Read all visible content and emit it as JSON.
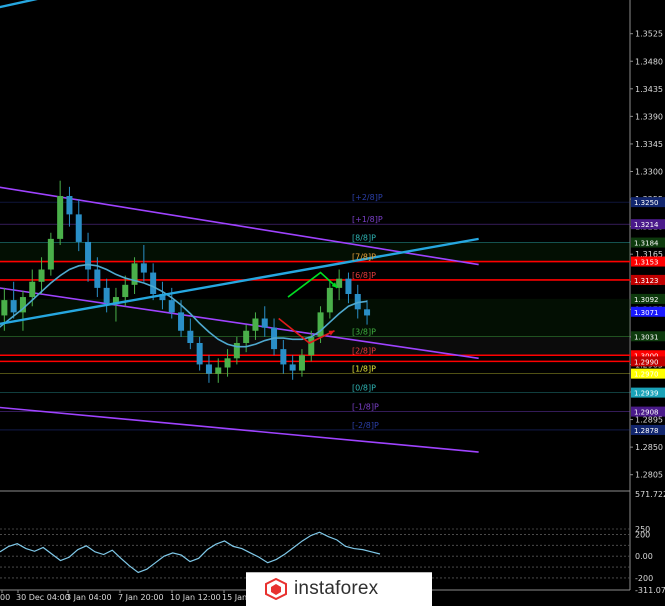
{
  "colors": {
    "background": "#000000",
    "axis": "#8c8c8c",
    "trend": "#26a7e0",
    "channel": "#9f43ff",
    "ma": "#4fa9cf",
    "bull": "#4ab04a",
    "bear": "#2a8fc7",
    "osc": "#7fc8e8",
    "level_red": "#ff0000",
    "arrow_up": "#00dd22",
    "arrow_down": "#e21a1a",
    "murrey_band_up": "#0d3a0d",
    "murrey_band_mid": "#2a2a2a",
    "logo_red": "#e8312f"
  },
  "chart_data": [
    {
      "type": "candlestick",
      "price_range": [
        1.278,
        1.358
      ],
      "y_ticks": [
        "1.3525",
        "1.3480",
        "1.3435",
        "1.3390",
        "1.3345",
        "1.3300",
        "1.3255",
        "1.3210",
        "1.3165",
        "1.3120",
        "1.3075",
        "1.3030",
        "1.2985",
        "1.2940",
        "1.2895",
        "1.2850",
        "1.2805"
      ],
      "x_ticks": [
        "00",
        "30 Dec 04:00",
        "3 Jan 04:00",
        "7 Jan 20:00",
        "10 Jan 12:00",
        "15 Jan"
      ],
      "grid": false,
      "price_badges": [
        {
          "text": "1.3250",
          "price": 1.325,
          "color": "#12266e"
        },
        {
          "text": "1.3214",
          "price": 1.3214,
          "color": "#4a1a8a"
        },
        {
          "text": "1.3184",
          "price": 1.3184,
          "color": "#0d3a0d"
        },
        {
          "text": "1.3153",
          "price": 1.3153,
          "color": "#ff0000"
        },
        {
          "text": "1.3123",
          "price": 1.3123,
          "color": "#c00000"
        },
        {
          "text": "1.3092",
          "price": 1.3092,
          "color": "#0d3a0d"
        },
        {
          "text": "1.3071",
          "price": 1.3071,
          "color": "#1a1aff"
        },
        {
          "text": "1.3031",
          "price": 1.3031,
          "color": "#0d3a0d"
        },
        {
          "text": "1.3000",
          "price": 1.3,
          "color": "#ff0000"
        },
        {
          "text": "1.2990",
          "price": 1.299,
          "color": "#c00000"
        },
        {
          "text": "1.2970",
          "price": 1.297,
          "color": "#ffff00"
        },
        {
          "text": "1.2939",
          "price": 1.2939,
          "color": "#1aa3b8"
        },
        {
          "text": "1.2908",
          "price": 1.2908,
          "color": "#4a1a8a"
        },
        {
          "text": "1.2878",
          "price": 1.2878,
          "color": "#12266e"
        }
      ],
      "murrey_labels": [
        {
          "text": "[+2/8]P",
          "price": 1.325,
          "color": "#2b3fa8"
        },
        {
          "text": "[+1/8]P",
          "price": 1.3214,
          "color": "#7a3fc8"
        },
        {
          "text": "[8/8]P",
          "price": 1.3184,
          "color": "#2fb5b5"
        },
        {
          "text": "[7/8]P",
          "price": 1.3153,
          "color": "#e6a23c"
        },
        {
          "text": "[6/8]P",
          "price": 1.3123,
          "color": "#e23c3c"
        },
        {
          "text": "[3/8]P",
          "price": 1.3031,
          "color": "#3fae3f"
        },
        {
          "text": "[2/8]P",
          "price": 1.3,
          "color": "#e23c3c"
        },
        {
          "text": "[1/8]P",
          "price": 1.297,
          "color": "#e6e63c"
        },
        {
          "text": "[0/8]P",
          "price": 1.2939,
          "color": "#2fb5b5"
        },
        {
          "text": "[-1/8]P",
          "price": 1.2908,
          "color": "#7a3fc8"
        },
        {
          "text": "[-2/8]P",
          "price": 1.2878,
          "color": "#2b3fa8"
        }
      ],
      "red_levels": [
        1.3153,
        1.3123,
        1.3,
        1.299
      ],
      "ohlc": [
        [
          1.302,
          1.3075,
          1.299,
          1.3065
        ],
        [
          1.3065,
          1.311,
          1.304,
          1.309
        ],
        [
          1.309,
          1.312,
          1.306,
          1.307
        ],
        [
          1.307,
          1.3105,
          1.304,
          1.3095
        ],
        [
          1.3095,
          1.314,
          1.308,
          1.312
        ],
        [
          1.312,
          1.316,
          1.31,
          1.314
        ],
        [
          1.314,
          1.32,
          1.313,
          1.319
        ],
        [
          1.319,
          1.3285,
          1.318,
          1.326
        ],
        [
          1.326,
          1.3275,
          1.321,
          1.323
        ],
        [
          1.323,
          1.3255,
          1.317,
          1.3185
        ],
        [
          1.3185,
          1.32,
          1.312,
          1.314
        ],
        [
          1.314,
          1.316,
          1.3095,
          1.311
        ],
        [
          1.311,
          1.3125,
          1.307,
          1.3085
        ],
        [
          1.3085,
          1.311,
          1.3055,
          1.3095
        ],
        [
          1.3095,
          1.313,
          1.308,
          1.3115
        ],
        [
          1.3115,
          1.316,
          1.31,
          1.315
        ],
        [
          1.315,
          1.318,
          1.312,
          1.3135
        ],
        [
          1.3135,
          1.315,
          1.309,
          1.31
        ],
        [
          1.31,
          1.312,
          1.3075,
          1.309
        ],
        [
          1.309,
          1.311,
          1.306,
          1.307
        ],
        [
          1.307,
          1.309,
          1.303,
          1.304
        ],
        [
          1.304,
          1.306,
          1.301,
          1.302
        ],
        [
          1.302,
          1.303,
          1.2975,
          1.2985
        ],
        [
          1.2985,
          1.3,
          1.2955,
          1.297
        ],
        [
          1.297,
          1.2995,
          1.2955,
          1.298
        ],
        [
          1.298,
          1.301,
          1.2965,
          1.2995
        ],
        [
          1.2995,
          1.303,
          1.2985,
          1.302
        ],
        [
          1.302,
          1.305,
          1.3005,
          1.304
        ],
        [
          1.304,
          1.307,
          1.3025,
          1.306
        ],
        [
          1.306,
          1.308,
          1.303,
          1.3045
        ],
        [
          1.3045,
          1.306,
          1.3,
          1.301
        ],
        [
          1.301,
          1.3025,
          1.297,
          1.2985
        ],
        [
          1.2985,
          1.3,
          1.296,
          1.2975
        ],
        [
          1.2975,
          1.301,
          1.2965,
          1.3
        ],
        [
          1.3,
          1.304,
          1.299,
          1.303
        ],
        [
          1.303,
          1.308,
          1.302,
          1.307
        ],
        [
          1.307,
          1.312,
          1.306,
          1.311
        ],
        [
          1.311,
          1.314,
          1.309,
          1.3125
        ],
        [
          1.3125,
          1.3135,
          1.3085,
          1.31
        ],
        [
          1.31,
          1.3115,
          1.306,
          1.3075
        ],
        [
          1.3075,
          1.309,
          1.305,
          1.3065
        ]
      ],
      "moving_average": [
        1.304,
        1.3052,
        1.3064,
        1.3076,
        1.309,
        1.3104,
        1.3118,
        1.313,
        1.314,
        1.3146,
        1.3148,
        1.3146,
        1.314,
        1.3132,
        1.3126,
        1.3122,
        1.3118,
        1.3112,
        1.3104,
        1.3094,
        1.3082,
        1.3068,
        1.3052,
        1.3038,
        1.3026,
        1.3018,
        1.3014,
        1.3014,
        1.3018,
        1.3024,
        1.3028,
        1.3028,
        1.3026,
        1.3026,
        1.303,
        1.304,
        1.3054,
        1.3068,
        1.308,
        1.3086,
        1.3088
      ],
      "trend_line": {
        "from": {
          "bar": -1.8,
          "price": 1.3045
        },
        "to": {
          "bar": 52,
          "price": 1.319
        }
      },
      "upper_trend_line": {
        "from": {
          "bar": -0.5,
          "price": 1.3565
        },
        "to": {
          "bar": 7,
          "price": 1.359
        }
      },
      "channel_lines": [
        {
          "from": {
            "bar": -1.8,
            "price": 1.328
          },
          "to": {
            "bar": 52,
            "price": 1.3148
          }
        },
        {
          "from": {
            "bar": -1.8,
            "price": 1.3115
          },
          "to": {
            "bar": 52,
            "price": 1.2995
          }
        },
        {
          "from": {
            "bar": -1.8,
            "price": 1.2918
          },
          "to": {
            "bar": 52,
            "price": 1.2842
          }
        }
      ],
      "arrows": [
        {
          "color": "up",
          "points": [
            {
              "bar": 31.5,
              "price": 1.3095
            },
            {
              "bar": 35,
              "price": 1.3135
            },
            {
              "bar": 36.8,
              "price": 1.311
            }
          ]
        },
        {
          "color": "down",
          "points": [
            {
              "bar": 30.5,
              "price": 1.306
            },
            {
              "bar": 33.8,
              "price": 1.302
            },
            {
              "bar": 36.5,
              "price": 1.304
            }
          ]
        }
      ]
    },
    {
      "type": "line",
      "name": "oscillator",
      "y_range": [
        -311.07,
        571.72
      ],
      "y_ticks": [
        "571.7224",
        "250",
        "200",
        "0.00",
        "-200",
        "-311.070"
      ],
      "reference_levels": [
        250,
        200,
        100,
        0,
        -100,
        -200
      ],
      "values": [
        40,
        90,
        115,
        70,
        45,
        80,
        20,
        -40,
        -10,
        60,
        95,
        40,
        15,
        55,
        -20,
        -90,
        -150,
        -120,
        -60,
        0,
        30,
        10,
        -50,
        -20,
        60,
        110,
        140,
        90,
        70,
        30,
        -10,
        -60,
        -30,
        20,
        80,
        140,
        190,
        220,
        180,
        150,
        90,
        70,
        60,
        40,
        20
      ]
    }
  ],
  "logo": {
    "text": "instaforex"
  }
}
